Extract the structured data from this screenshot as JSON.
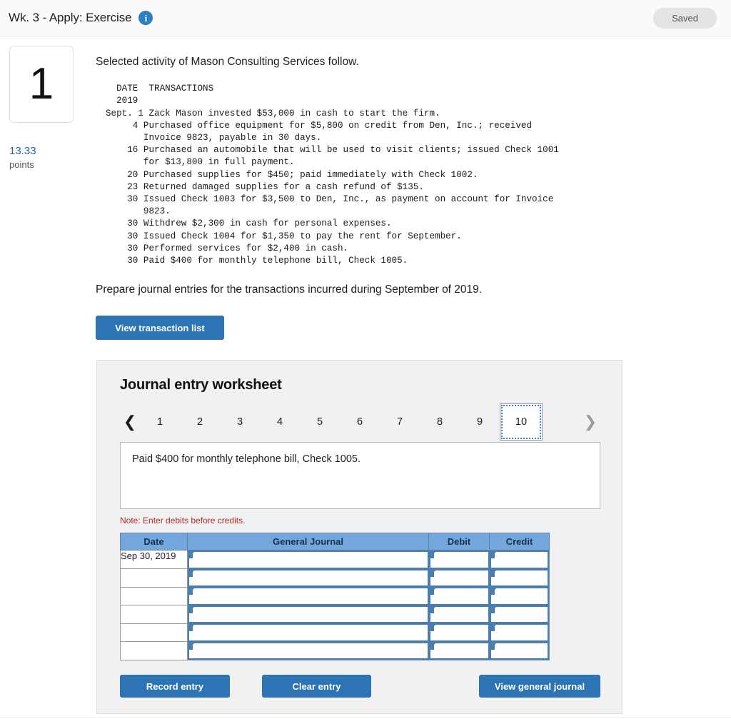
{
  "header": {
    "title": "Wk. 3 - Apply: Exercise",
    "info_icon": "info-icon",
    "saved_label": "Saved"
  },
  "question": {
    "number": "1",
    "points_value": "13.33",
    "points_label": "points"
  },
  "content": {
    "intro": "Selected activity of Mason Consulting Services follow.",
    "transactions_text": "  DATE  TRANSACTIONS\n  2019\nSept. 1 Zack Mason invested $53,000 in cash to start the firm.\n     4 Purchased office equipment for $5,800 on credit from Den, Inc.; received\n       Invoice 9823, payable in 30 days.\n    16 Purchased an automobile that will be used to visit clients; issued Check 1001\n       for $13,800 in full payment.\n    20 Purchased supplies for $450; paid immediately with Check 1002.\n    23 Returned damaged supplies for a cash refund of $135.\n    30 Issued Check 1003 for $3,500 to Den, Inc., as payment on account for Invoice\n       9823.\n    30 Withdrew $2,300 in cash for personal expenses.\n    30 Issued Check 1004 for $1,350 to pay the rent for September.\n    30 Performed services for $2,400 in cash.\n    30 Paid $400 for monthly telephone bill, Check 1005.",
    "prompt": "Prepare journal entries for the transactions incurred during September of 2019.",
    "view_transaction_list_label": "View transaction list"
  },
  "worksheet": {
    "title": "Journal entry worksheet",
    "pager": {
      "prev_icon": "chevron-left-icon",
      "next_icon": "chevron-right-icon",
      "pages": [
        "1",
        "2",
        "3",
        "4",
        "5",
        "6",
        "7",
        "8",
        "9",
        "10"
      ],
      "active_page": "10"
    },
    "transaction_text": "Paid $400 for monthly telephone bill, Check 1005.",
    "note": "Note: Enter debits before credits.",
    "table": {
      "columns": [
        "Date",
        "General Journal",
        "Debit",
        "Credit"
      ],
      "rows": [
        {
          "date": "Sep 30, 2019",
          "general_journal": "",
          "debit": "",
          "credit": ""
        },
        {
          "date": "",
          "general_journal": "",
          "debit": "",
          "credit": ""
        },
        {
          "date": "",
          "general_journal": "",
          "debit": "",
          "credit": ""
        },
        {
          "date": "",
          "general_journal": "",
          "debit": "",
          "credit": ""
        },
        {
          "date": "",
          "general_journal": "",
          "debit": "",
          "credit": ""
        },
        {
          "date": "",
          "general_journal": "",
          "debit": "",
          "credit": ""
        }
      ]
    },
    "actions": {
      "record_label": "Record entry",
      "clear_label": "Clear entry",
      "view_general_journal_label": "View general journal"
    }
  },
  "colors": {
    "accent_blue": "#2c74b3",
    "table_header_blue": "#74a8dc",
    "cell_border_blue": "#4a7eb0",
    "note_red": "#b02a2a",
    "points_blue": "#2a6496",
    "panel_gray": "#f1f1f1"
  }
}
